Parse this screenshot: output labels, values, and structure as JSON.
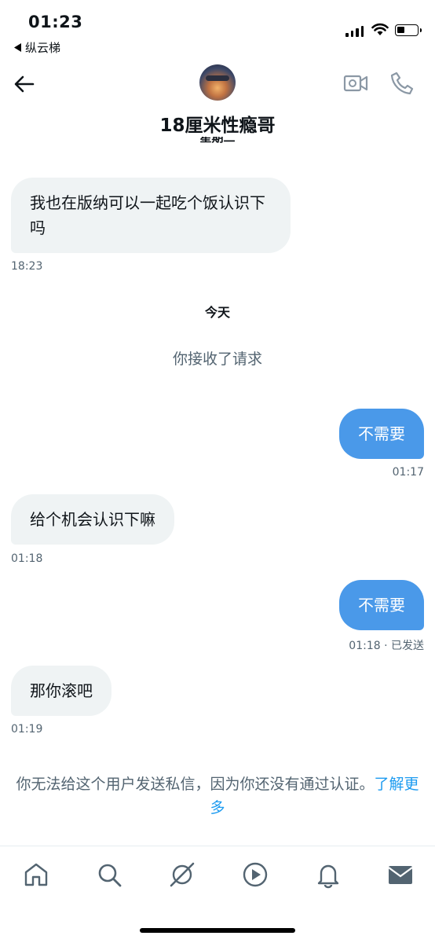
{
  "status_bar": {
    "time": "01:23",
    "back_app": "纵云梯"
  },
  "header": {
    "contact_name": "18厘米性瘾哥",
    "peek_label": "星期二"
  },
  "messages": [
    {
      "direction": "incoming",
      "text": "我也在版纳可以一起吃个饭认识下吗",
      "time": "18:23"
    },
    {
      "direction": "outgoing",
      "text": "不需要",
      "time": "01:17"
    },
    {
      "direction": "incoming",
      "text": "给个机会认识下嘛",
      "time": "01:18"
    },
    {
      "direction": "outgoing",
      "text": "不需要",
      "time": "01:18 · 已发送"
    },
    {
      "direction": "incoming",
      "text": "那你滚吧",
      "time": "01:19"
    }
  ],
  "date_separator": "今天",
  "system_notice": "你接收了请求",
  "footer_notice": {
    "text": "你无法给这个用户发送私信，因为你还没有通过认证。",
    "link": "了解更多"
  },
  "tabbar": {
    "icons": [
      "home-icon",
      "search-icon",
      "spaces-icon",
      "video-icon",
      "notifications-icon",
      "messages-icon"
    ]
  },
  "colors": {
    "accent": "#1d9bf0",
    "outgoing_bubble": "#4a99e9",
    "incoming_bubble": "#eff3f4",
    "muted_text": "#536471"
  }
}
